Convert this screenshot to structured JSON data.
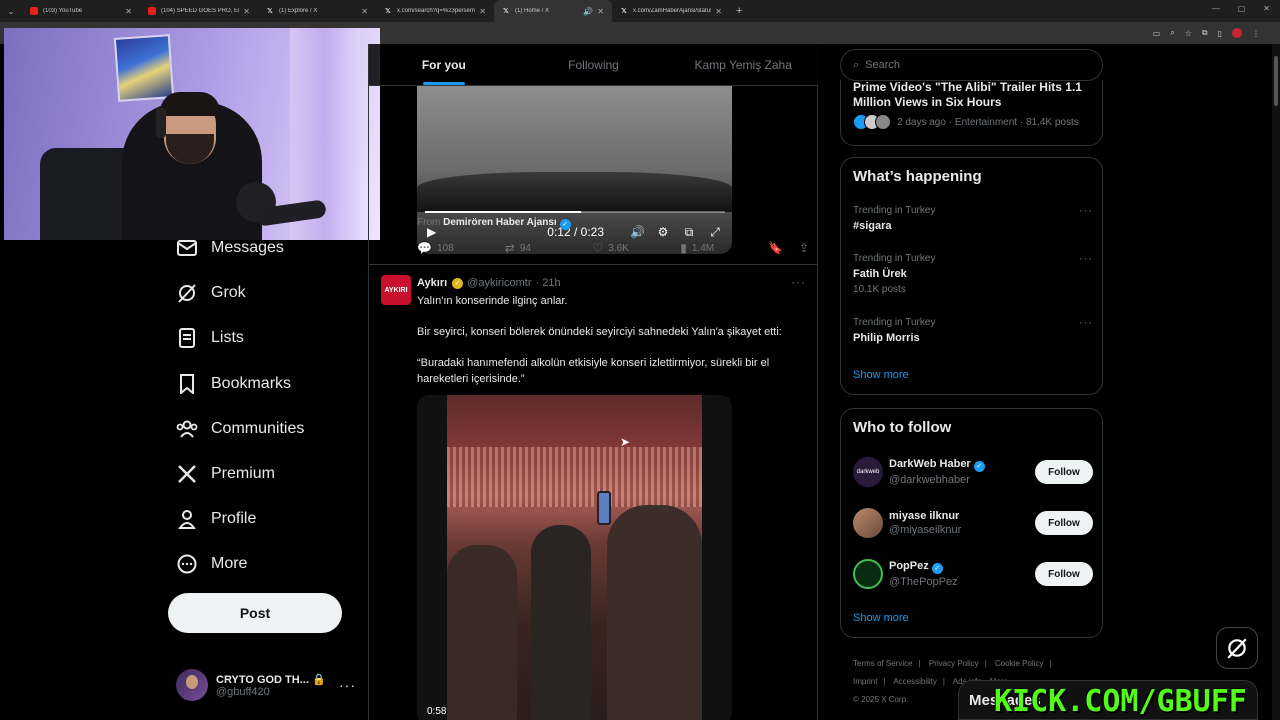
{
  "browser": {
    "tabs": [
      {
        "title": "(103) YouTube",
        "icon": "youtube-icon"
      },
      {
        "title": "(104) SPEED GOES PRO, EPISOI",
        "icon": "youtube-icon"
      },
      {
        "title": "(1) Explore / X",
        "icon": "x-icon"
      },
      {
        "title": "x.com/search?q=%23persemb",
        "icon": "x-icon"
      },
      {
        "title": "(1) Home / X",
        "icon": "x-icon",
        "active": true
      },
      {
        "title": "x.com/ZamHaberAjansi/status/",
        "icon": "x-icon"
      }
    ]
  },
  "nav": {
    "items": [
      {
        "label": "Messages",
        "icon": "envelope-icon"
      },
      {
        "label": "Grok",
        "icon": "grok-icon"
      },
      {
        "label": "Lists",
        "icon": "list-icon"
      },
      {
        "label": "Bookmarks",
        "icon": "bookmark-icon"
      },
      {
        "label": "Communities",
        "icon": "communities-icon"
      },
      {
        "label": "Premium",
        "icon": "x-logo-icon"
      },
      {
        "label": "Profile",
        "icon": "person-icon"
      },
      {
        "label": "More",
        "icon": "more-circle-icon"
      }
    ],
    "post_label": "Post",
    "account": {
      "name": "CRYTO GOD TH...",
      "handle": "@gbuff420"
    }
  },
  "feed": {
    "tabs": [
      "For you",
      "Following",
      "Kamp Yemiş Zaha"
    ],
    "tweet1": {
      "video_time": "0:12 / 0:23",
      "video_progress": 0.52,
      "from_prefix": "From",
      "from_name": "Demirören Haber Ajansı",
      "replies": "108",
      "reposts": "94",
      "likes": "3.6K",
      "views": "1.4M"
    },
    "tweet2": {
      "avatar_text": "AYKIRI",
      "name": "Aykırı",
      "handle": "@aykiricomtr",
      "time": "· 21h",
      "line1": "Yalın'ın konserinde ilginç anlar.",
      "line2": "Bir seyirci, konseri bölerek önündeki seyirciyi sahnedeki Yalın'a şikayet etti:",
      "line3": "“Buradaki hanımefendi alkolün etkisiyle konseri izlettirmiyor, sürekli bir el hareketleri içerisinde.”",
      "video_duration": "0:58"
    }
  },
  "sidebar": {
    "search_placeholder": "Search",
    "news": {
      "title": "Prime Video's \"The Alibi\" Trailer Hits 1.1 Million Views in Six Hours",
      "meta": "2 days ago · Entertainment · 81.4K posts"
    },
    "happening": {
      "heading": "What’s happening",
      "trends": [
        {
          "context": "Trending in Turkey",
          "name": "#sigara",
          "count": ""
        },
        {
          "context": "Trending in Turkey",
          "name": "Fatih Ürek",
          "count": "10.1K posts"
        },
        {
          "context": "Trending in Turkey",
          "name": "Philip Morris",
          "count": ""
        }
      ],
      "show_more": "Show more"
    },
    "who_to_follow": {
      "heading": "Who to follow",
      "accounts": [
        {
          "name": "DarkWeb Haber",
          "handle": "@darkwebhaber",
          "avatar_text": "darkweb",
          "follow": "Follow"
        },
        {
          "name": "miyase ilknur",
          "handle": "@miyaseilknur",
          "avatar_text": "",
          "follow": "Follow"
        },
        {
          "name": "PopPez",
          "handle": "@ThePopPez",
          "avatar_text": "",
          "follow": "Follow"
        }
      ],
      "show_more": "Show more"
    },
    "footer": {
      "links": [
        "Terms of Service",
        "Privacy Policy",
        "Cookie Policy",
        "Imprint",
        "Accessibility",
        "Ads info",
        "More"
      ],
      "copyright": "© 2025 X Corp."
    }
  },
  "messages_drawer": "Messages",
  "overlay_text": "KICK.COM/GBUFF",
  "colors": {
    "accent": "#1d9bf0",
    "kick_green": "#53fc18",
    "background": "#000000"
  }
}
